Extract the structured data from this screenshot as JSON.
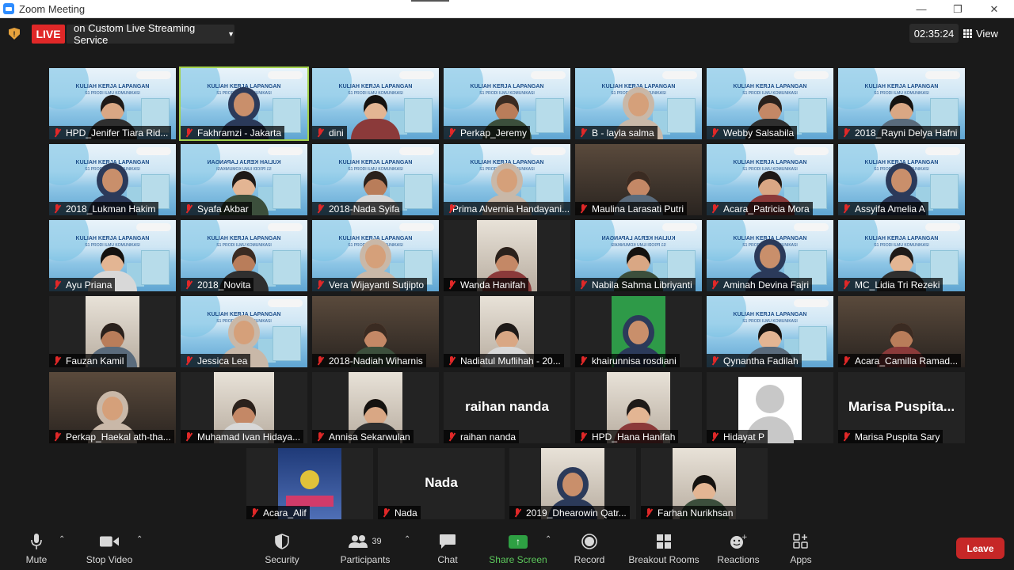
{
  "window": {
    "title": "Zoom Meeting"
  },
  "top": {
    "live_label": "LIVE",
    "live_service": "on Custom Live Streaming Service",
    "timer": "02:35:24",
    "view_label": "View"
  },
  "tiles": [
    {
      "name": "HPD_Jenifer Tiara Rid...",
      "bg": "banner"
    },
    {
      "name": "Fakhramzi - Jakarta",
      "bg": "banner",
      "active": true
    },
    {
      "name": "dini",
      "bg": "banner"
    },
    {
      "name": "Perkap_Jeremy",
      "bg": "banner"
    },
    {
      "name": "B - layla salma",
      "bg": "banner"
    },
    {
      "name": "Webby Salsabila",
      "bg": "banner"
    },
    {
      "name": "2018_Rayni Delya Hafni",
      "bg": "banner"
    },
    {
      "name": "2018_Lukman Hakim",
      "bg": "banner"
    },
    {
      "name": "Syafa Akbar",
      "bg": "banner-flipped"
    },
    {
      "name": "2018-Nada Syifa",
      "bg": "banner"
    },
    {
      "name": "Prima Alvernia Handayani...",
      "bg": "banner"
    },
    {
      "name": "Maulina Larasati Putri",
      "bg": "room"
    },
    {
      "name": "Acara_Patricia Mora",
      "bg": "banner"
    },
    {
      "name": "Assyifa Amelia A",
      "bg": "banner"
    },
    {
      "name": "Ayu Priana",
      "bg": "banner"
    },
    {
      "name": "2018_Novita",
      "bg": "banner"
    },
    {
      "name": "Vera Wijayanti Sutjipto",
      "bg": "banner"
    },
    {
      "name": "Wanda Hanifah",
      "bg": "cam"
    },
    {
      "name": "Nabila Sahma Libriyanti",
      "bg": "banner-flipped"
    },
    {
      "name": "Aminah Devina Fajri",
      "bg": "banner"
    },
    {
      "name": "MC_Lidia Tri Rezeki",
      "bg": "banner"
    },
    {
      "name": "Fauzan Kamil",
      "bg": "cam"
    },
    {
      "name": "Jessica Lea",
      "bg": "banner"
    },
    {
      "name": "2018-Nadiah Wiharnis",
      "bg": "room"
    },
    {
      "name": "Nadiatul Muflihah - 20...",
      "bg": "cam"
    },
    {
      "name": "khairunnisa rosdiani",
      "bg": "green"
    },
    {
      "name": "Qynantha Fadilah",
      "bg": "banner"
    },
    {
      "name": "Acara_Camilla Ramad...",
      "bg": "room"
    },
    {
      "name": "Perkap_Haekal ath-tha...",
      "bg": "room"
    },
    {
      "name": "Muhamad Ivan Hidaya...",
      "bg": "cam"
    },
    {
      "name": "Annisa Sekarwulan",
      "bg": "cam"
    },
    {
      "name": "raihan nanda",
      "bg": "name",
      "display": "raihan nanda"
    },
    {
      "name": "HPD_Hana Hanifah",
      "bg": "cam"
    },
    {
      "name": "Hidayat P",
      "bg": "avatar"
    },
    {
      "name": "Marisa Puspita Sary",
      "bg": "name",
      "display": "Marisa  Puspita..."
    },
    {
      "name": "Acara_Alif",
      "bg": "poster"
    },
    {
      "name": "Nada",
      "bg": "name",
      "display": "Nada"
    },
    {
      "name": "2019_Dhearowin Qatr...",
      "bg": "cam"
    },
    {
      "name": "Farhan Nurikhsan",
      "bg": "cam"
    }
  ],
  "banner_text": "KULIAH KERJA LAPANGAN",
  "banner_sub": "S1 PRODI ILMU KOMUNIKASI",
  "toolbar": {
    "mute": "Mute",
    "stop_video": "Stop Video",
    "security": "Security",
    "participants": "Participants",
    "participants_count": "39",
    "chat": "Chat",
    "share_screen": "Share Screen",
    "record": "Record",
    "breakout_rooms": "Breakout Rooms",
    "reactions": "Reactions",
    "apps": "Apps",
    "leave": "Leave"
  },
  "colors": {
    "live": "#e02828",
    "active_speaker": "#a3d14d",
    "share": "#2ea043",
    "leave": "#c62727"
  }
}
